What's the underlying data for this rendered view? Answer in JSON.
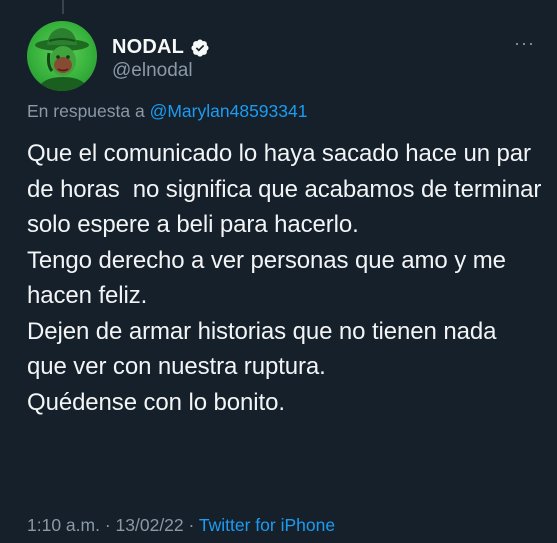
{
  "colors": {
    "background": "#15202b",
    "text": "#f2f4f5",
    "secondary_text": "#8b98a5",
    "accent": "#1d9bf0",
    "avatar_background": "#37b23c"
  },
  "author": {
    "display_name": "NODAL",
    "handle": "@elnodal",
    "verified_icon": "verified-badge-icon",
    "avatar_icon": "avatar-cowboy-icon"
  },
  "more_menu": {
    "label": "···",
    "icon": "more-options-icon"
  },
  "reply_context": {
    "prefix": "En respuesta a",
    "mention": "@Marylan48593341"
  },
  "tweet": {
    "lines": [
      "Que el comunicado lo haya sacado hace un par de horas  no significa que acabamos de terminar solo espere a beli para hacerlo.",
      "Tengo derecho a ver personas que amo y me hacen feliz.",
      "Dejen de armar historias que no tienen nada que ver con nuestra ruptura.",
      "Quédense con lo bonito."
    ]
  },
  "meta": {
    "time": "1:10 a.m.",
    "separator1": " · ",
    "date": "13/02/22",
    "separator2": " · ",
    "source": "Twitter for iPhone"
  }
}
